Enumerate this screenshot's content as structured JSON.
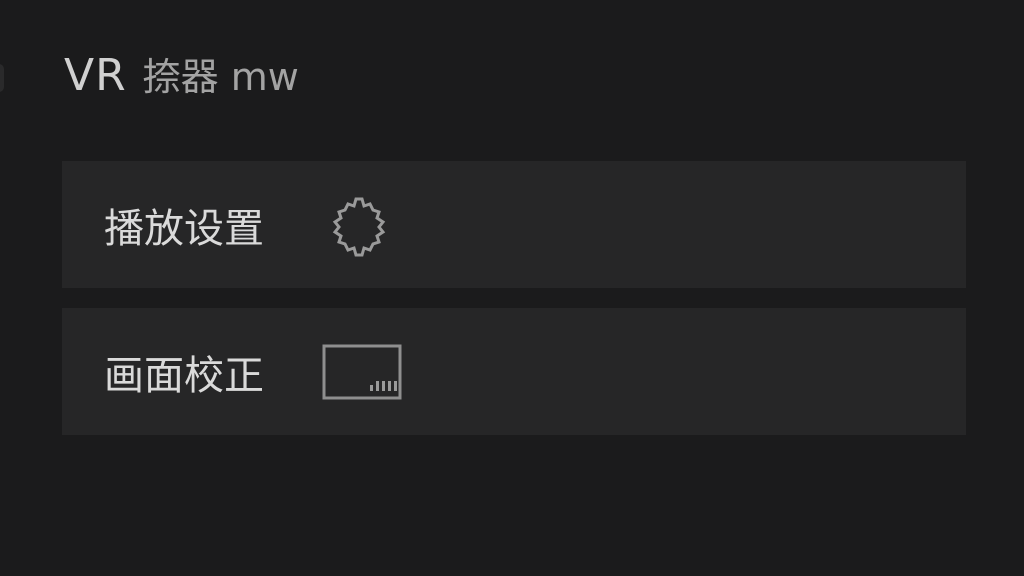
{
  "header": {
    "title_vr": "VR",
    "title_rest": "捺器 mw"
  },
  "menu": {
    "items": [
      {
        "label": "播放设置",
        "icon": "gear-icon"
      },
      {
        "label": "画面校正",
        "icon": "screen-calibration-icon"
      }
    ]
  }
}
